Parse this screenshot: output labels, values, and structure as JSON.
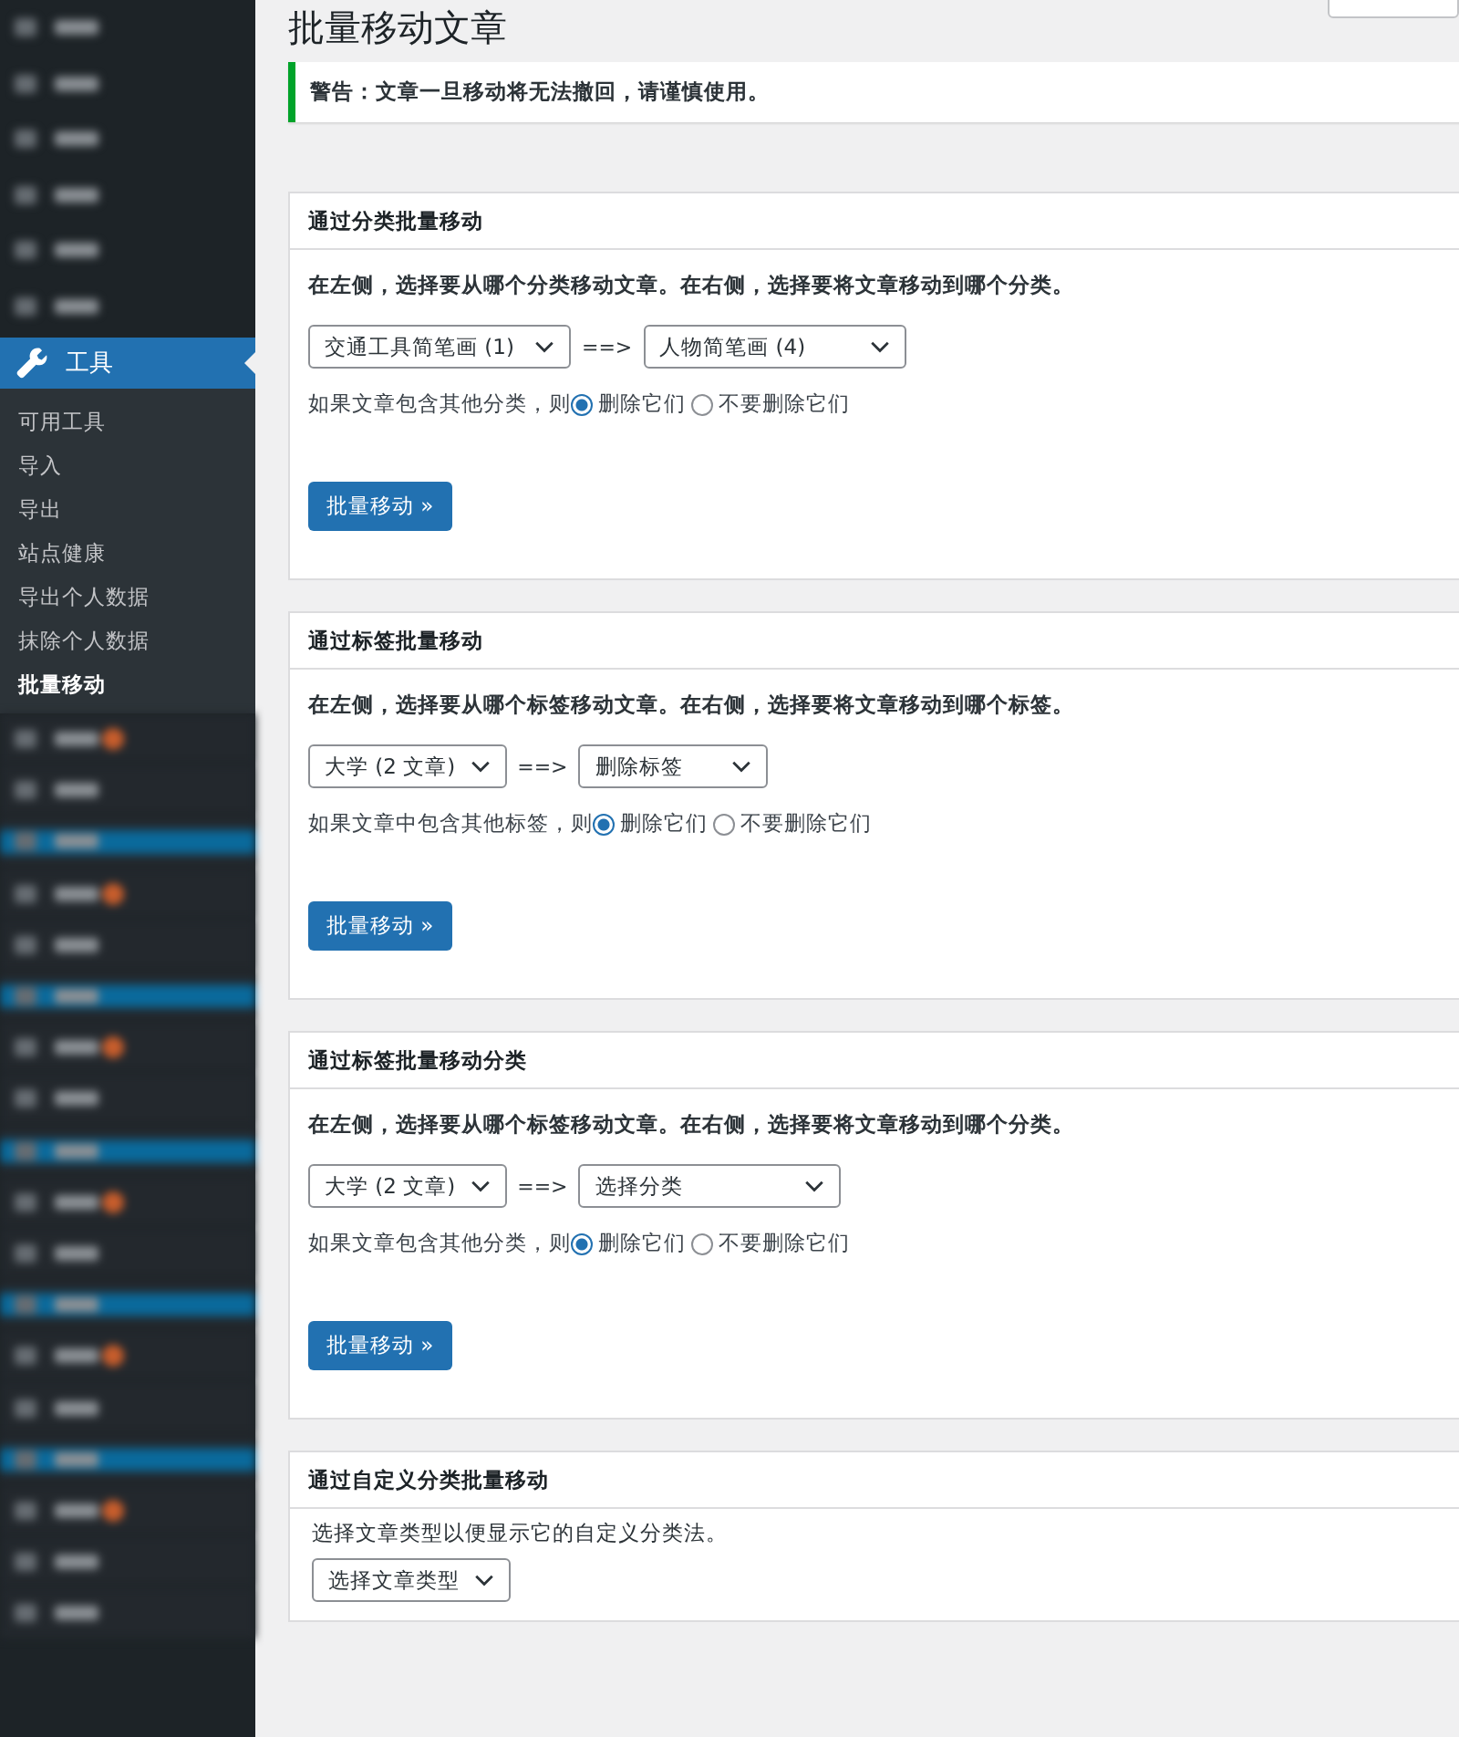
{
  "sidebar": {
    "active_menu": {
      "label": "工具"
    },
    "submenu": [
      {
        "label": "可用工具",
        "selected": false
      },
      {
        "label": "导入",
        "selected": false
      },
      {
        "label": "导出",
        "selected": false
      },
      {
        "label": "站点健康",
        "selected": false
      },
      {
        "label": "导出个人数据",
        "selected": false
      },
      {
        "label": "抹除个人数据",
        "selected": false
      },
      {
        "label": "批量移动",
        "selected": true
      }
    ]
  },
  "page": {
    "title": "批量移动文章",
    "notice": "警告：文章一旦移动将无法撤回，请谨慎使用。"
  },
  "sections": [
    {
      "kind": "move",
      "title": "通过分类批量移动",
      "description": "在左侧，选择要从哪个分类移动文章。在右侧，选择要将文章移动到哪个分类。",
      "source": "交通工具简笔画 (1)",
      "arrow": "==>",
      "target": "人物简笔画 (4)",
      "option_label": "如果文章包含其他分类，则",
      "options": [
        {
          "label": "删除它们",
          "selected": true
        },
        {
          "label": "不要删除它们",
          "selected": false
        }
      ],
      "button": "批量移动 »"
    },
    {
      "kind": "move",
      "title": "通过标签批量移动",
      "description": "在左侧，选择要从哪个标签移动文章。在右侧，选择要将文章移动到哪个标签。",
      "source": "大学 (2 文章)",
      "arrow": "==>",
      "target": "删除标签",
      "option_label": "如果文章中包含其他标签，则",
      "options": [
        {
          "label": "删除它们",
          "selected": true
        },
        {
          "label": "不要删除它们",
          "selected": false
        }
      ],
      "button": "批量移动 »"
    },
    {
      "kind": "move",
      "title": "通过标签批量移动分类",
      "description": "在左侧，选择要从哪个标签移动文章。在右侧，选择要将文章移动到哪个分类。",
      "source": "大学 (2 文章)",
      "arrow": "==>",
      "target": "选择分类",
      "option_label": "如果文章包含其他分类，则",
      "options": [
        {
          "label": "删除它们",
          "selected": true
        },
        {
          "label": "不要删除它们",
          "selected": false
        }
      ],
      "button": "批量移动 »"
    },
    {
      "kind": "post_type",
      "title": "通过自定义分类批量移动",
      "description": "选择文章类型以便显示它的自定义分类法。",
      "source": "选择文章类型"
    }
  ]
}
